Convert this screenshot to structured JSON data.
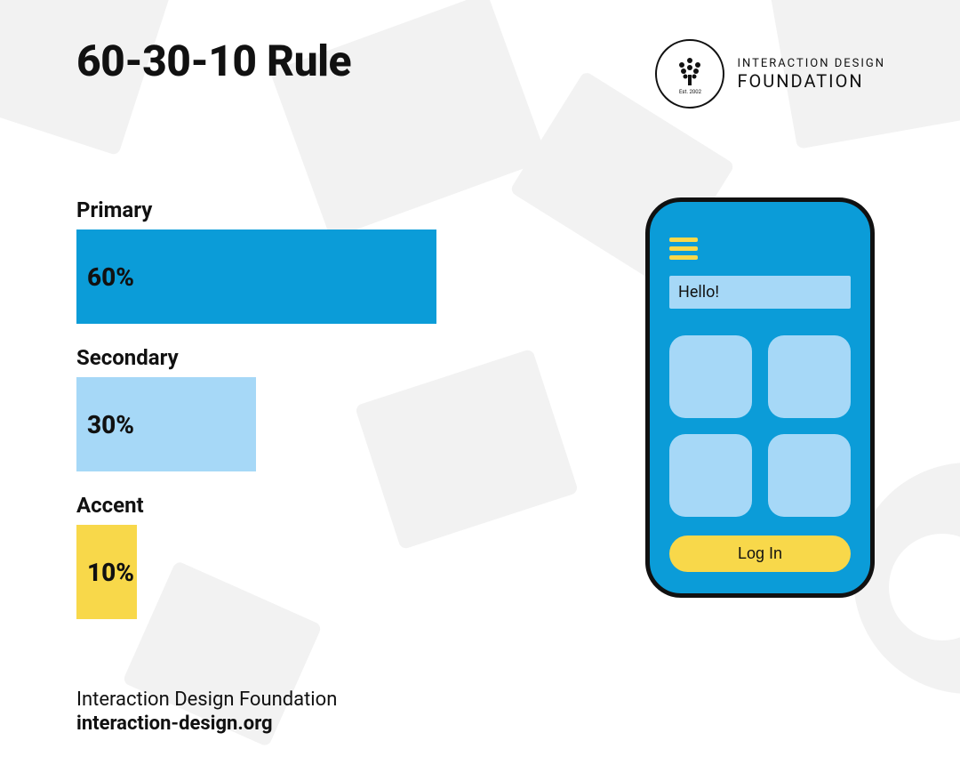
{
  "title": "60-30-10 Rule",
  "logo": {
    "line1": "INTERACTION DESIGN",
    "line2": "FOUNDATION",
    "est": "Est. 2002"
  },
  "colors": {
    "primary": "#0b9cd8",
    "secondary": "#a6d8f7",
    "accent": "#f8d84a"
  },
  "chart_data": {
    "type": "bar",
    "categories": [
      "Primary",
      "Secondary",
      "Accent"
    ],
    "values": [
      60,
      30,
      10
    ],
    "series_colors": [
      "#0b9cd8",
      "#a6d8f7",
      "#f8d84a"
    ],
    "title": "60-30-10 Rule",
    "xlabel": "",
    "ylabel": "",
    "ylim": [
      0,
      100
    ]
  },
  "bars": {
    "primary": {
      "label": "Primary",
      "value": "60%"
    },
    "secondary": {
      "label": "Secondary",
      "value": "30%"
    },
    "accent": {
      "label": "Accent",
      "value": "10%"
    }
  },
  "phone": {
    "greeting": "Hello!",
    "login": "Log In"
  },
  "footer": {
    "line1": "Interaction Design Foundation",
    "line2": "interaction-design.org"
  }
}
